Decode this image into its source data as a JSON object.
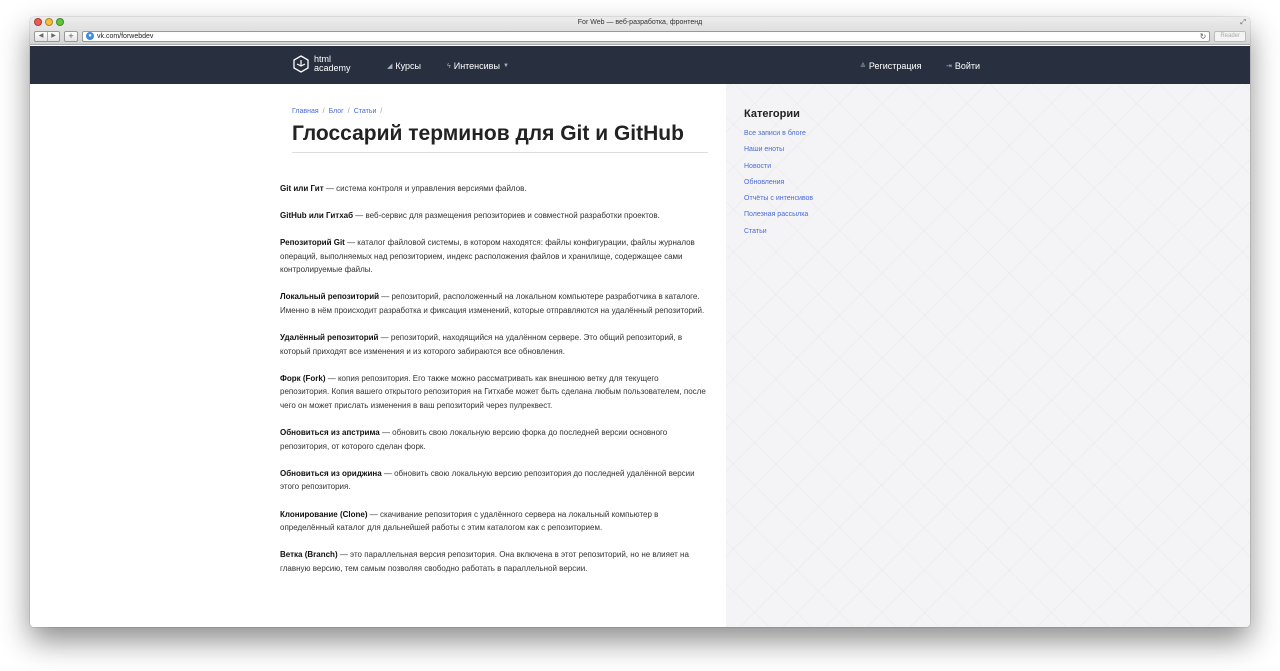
{
  "browser": {
    "title": "For Web — веб-разработка, фронтенд",
    "url": "vk.com/forwebdev",
    "reader_label": "Reader"
  },
  "header": {
    "logo_line1": "html",
    "logo_line2": "academy",
    "courses": "Курсы",
    "intensives": "Интенсивы",
    "register": "Регистрация",
    "login": "Войти"
  },
  "breadcrumbs": [
    "Главная",
    "Блог",
    "Статьи"
  ],
  "page_title": "Глоссарий терминов для Git и GitHub",
  "article": [
    {
      "term": "Git или Гит",
      "text": " — система контроля и управления версиями файлов."
    },
    {
      "term": "GitHub или Гитхаб",
      "text": " — веб-сервис для размещения репозиториев и совместной разработки проектов."
    },
    {
      "term": "Репозиторий Git",
      "text": " — каталог файловой системы, в котором находятся: файлы конфигурации, файлы журналов операций, выполняемых над репозиторием, индекс расположения файлов и хранилище, содержащее сами контролируемые файлы."
    },
    {
      "term": "Локальный репозиторий",
      "text": " — репозиторий, расположенный на локальном компьютере разработчика в каталоге. Именно в нём происходит разработка и фиксация изменений, которые отправляются на удалённый репозиторий."
    },
    {
      "term": "Удалённый репозиторий",
      "text": " — репозиторий, находящийся на удалённом сервере. Это общий репозиторий, в который приходят все изменения и из которого забираются все обновления."
    },
    {
      "term": "Форк (Fork)",
      "text": " — копия репозитория. Его также можно рассматривать как внешнюю ветку для текущего репозитория. Копия вашего открытого репозитория на Гитхабе может быть сделана любым пользователем, после чего он может прислать изменения в ваш репозиторий через пулреквест."
    },
    {
      "term": "Обновиться из апстрима",
      "text": " — обновить свою локальную версию форка до последней версии основного репозитория, от которого сделан форк."
    },
    {
      "term": "Обновиться из ориджина",
      "text": " — обновить свою локальную версию репозитория до последней удалённой версии этого репозитория."
    },
    {
      "term": "Клонирование (Clone)",
      "text": " — скачивание репозитория с удалённого сервера на локальный компьютер в определённый каталог для дальнейшей работы с этим каталогом как с репозиторием."
    },
    {
      "term": "Ветка (Branch)",
      "text": " — это параллельная версия репозитория. Она включена в этот репозиторий, но не влияет на главную версию, тем самым позволяя свободно работать в параллельной версии."
    }
  ],
  "sidebar": {
    "title": "Категории",
    "items": [
      "Все записи в блоге",
      "Наши еноты",
      "Новости",
      "Обновления",
      "Отчёты с интенсивов",
      "Полезная рассылка",
      "Статьи"
    ]
  }
}
